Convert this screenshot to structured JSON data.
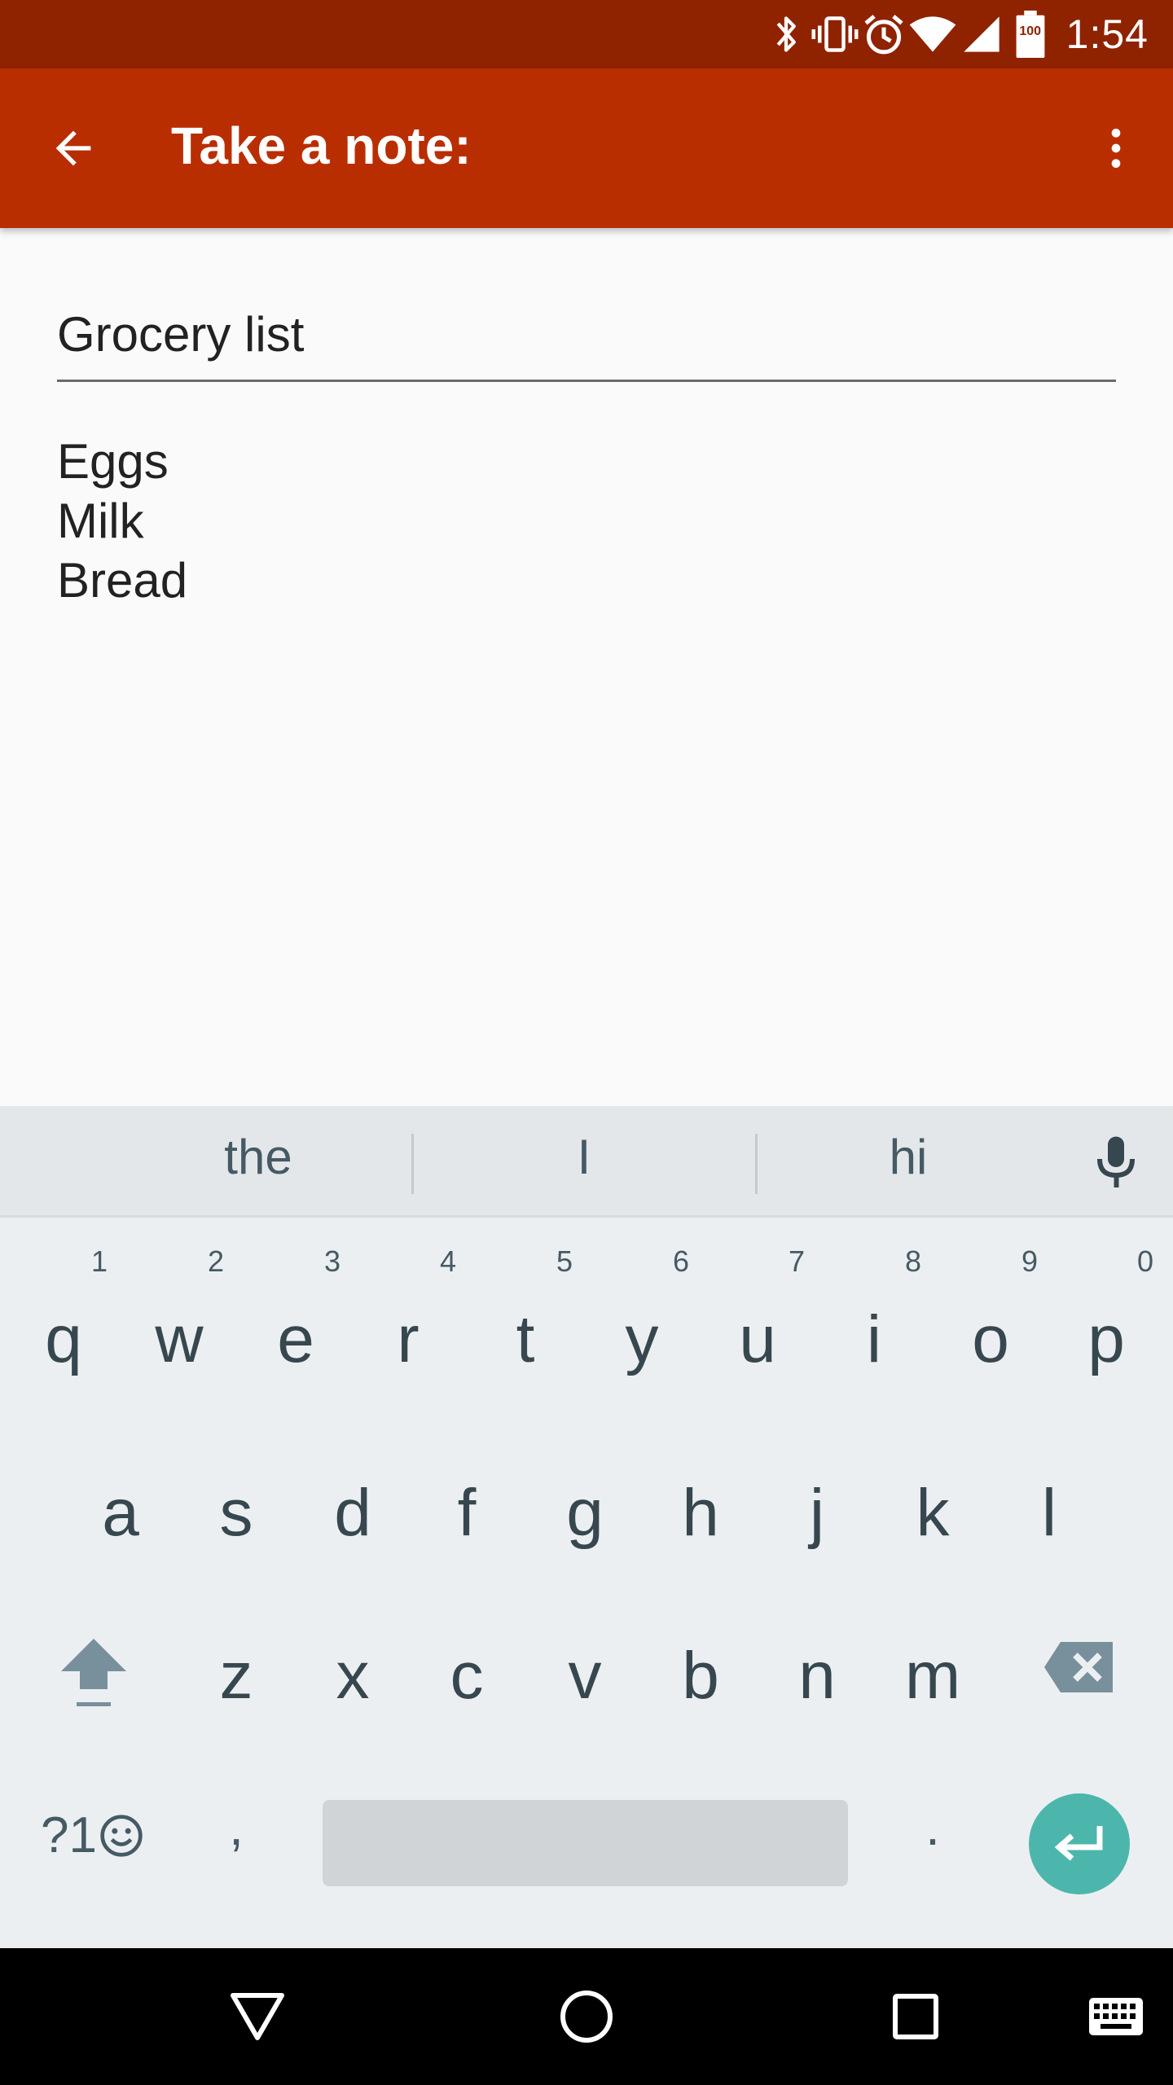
{
  "status_bar": {
    "time": "1:54",
    "battery_level": "100",
    "icons": [
      "bluetooth-icon",
      "vibrate-icon",
      "alarm-icon",
      "wifi-icon",
      "cell-signal-icon",
      "battery-icon"
    ]
  },
  "app_bar": {
    "title": "Take a note:",
    "background_color": "#b92e00",
    "status_color": "#8f2300"
  },
  "note": {
    "title_value": "Grocery list",
    "body_lines": [
      "Eggs",
      "Milk",
      "Bread"
    ]
  },
  "keyboard": {
    "suggestions": [
      "the",
      "I",
      "hi"
    ],
    "row1": [
      "q",
      "w",
      "e",
      "r",
      "t",
      "y",
      "u",
      "i",
      "o",
      "p"
    ],
    "row1_hints": [
      "1",
      "2",
      "3",
      "4",
      "5",
      "6",
      "7",
      "8",
      "9",
      "0"
    ],
    "row2": [
      "a",
      "s",
      "d",
      "f",
      "g",
      "h",
      "j",
      "k",
      "l"
    ],
    "row3": [
      "z",
      "x",
      "c",
      "v",
      "b",
      "n",
      "m"
    ],
    "symbols_label": "?1",
    "comma": ",",
    "period": ".",
    "enter_color": "#4db6ac"
  }
}
